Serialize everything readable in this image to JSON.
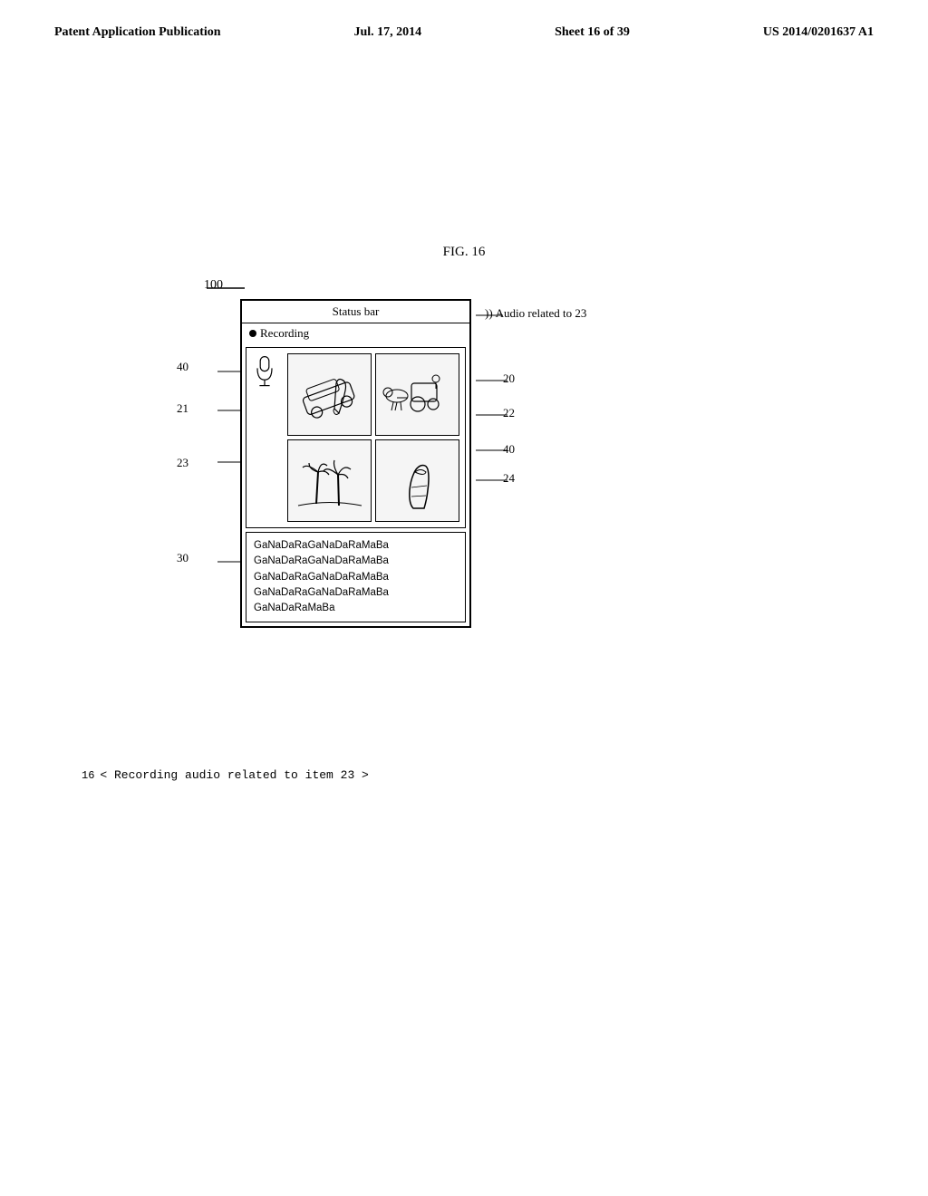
{
  "header": {
    "left": "Patent Application Publication",
    "center": "Jul. 17, 2014",
    "sheet": "Sheet 16 of 39",
    "patent": "US 2014/0201637 A1"
  },
  "figure": {
    "label": "FIG. 16"
  },
  "diagram": {
    "ref_main": "100",
    "status_bar_label": "Status bar",
    "recording_label": "● Recording",
    "recording_dot_label": "Recording",
    "text_lines": [
      "GaNaDaRaGaNaDaRaMaBa",
      "GaNaDaRaGaNaDaRaMaBa",
      "GaNaDaRaGaNaDaRaMaBa",
      "GaNaDaRaGaNaDaRaMaBa",
      "GaNaDaRaMaBa"
    ],
    "audio_annotation": "Audio related to 23",
    "audio_icon": "))",
    "bottom_caption": "< Recording audio related to item 23 >",
    "ref_numbers": {
      "r40_top": "40",
      "r21": "21",
      "r20": "20",
      "r22": "22",
      "r40_bottom": "40",
      "r23": "23",
      "r24": "24",
      "r30": "30",
      "r16": "16"
    }
  }
}
